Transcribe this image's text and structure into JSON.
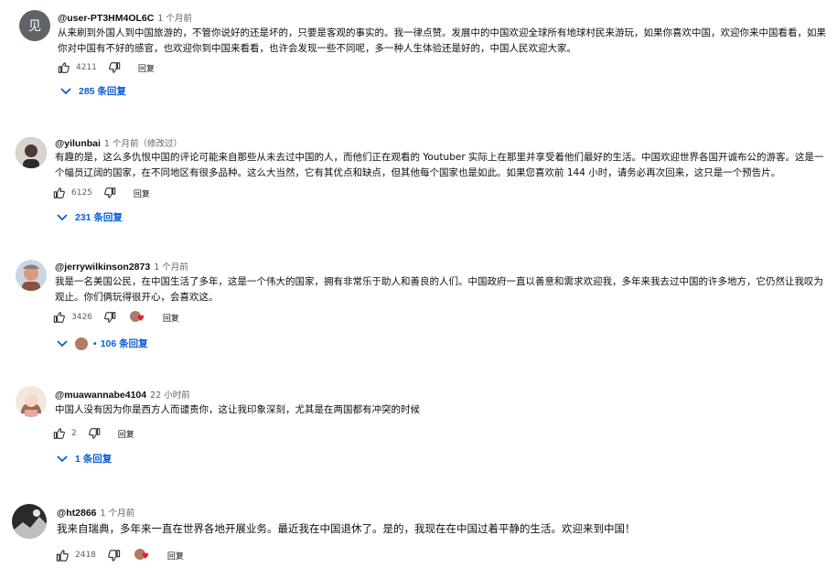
{
  "comments": [
    {
      "avatar_letter": "见",
      "author": "@user-PT3HM4OL6C",
      "time": "1 个月前",
      "text": "从来刷到外国人到中国旅游的，不管你说好的还是坏的，只要是客观的事实的。我一律点赞。发展中的中国欢迎全球所有地球村民来游玩，如果你喜欢中国，欢迎你来中国看看，如果你对中国有不好的感官，也欢迎你到中国来看看，也许会发现一些不同呢，多一种人生体验还是好的，中国人民欢迎大家。",
      "likes": "4211",
      "reply_label": "回复",
      "replies_label": "285 条回复"
    },
    {
      "author": "@yilunbai",
      "time": "1 个月前（修改过）",
      "text": "有趣的是，这么多仇恨中国的评论可能来自那些从未去过中国的人，而他们正在观看的 Youtuber 实际上在那里并享受着他们最好的生活。中国欢迎世界各国开诚布公的游客。这是一个幅员辽阔的国家，在不同地区有很多品种。这么大当然，它有其优点和缺点，但其他每个国家也是如此。如果您喜欢前 144 小时，请务必再次回来，这只是一个预告片。",
      "likes": "6125",
      "reply_label": "回复",
      "replies_label": "231 条回复"
    },
    {
      "author": "@jerrywilkinson2873",
      "time": "1 个月前",
      "text": "我是一名美国公民，在中国生活了多年，这是一个伟大的国家，拥有非常乐于助人和善良的人们。中国政府一直以善意和需求欢迎我，多年来我去过中国的许多地方，它仍然让我叹为观止。你们俩玩得很开心，会喜欢这。",
      "likes": "3426",
      "reply_label": "回复",
      "replies_label": "106 条回复"
    },
    {
      "author": "@muawannabe4104",
      "time": "22 小时前",
      "text": "中国人没有因为你是西方人而谴责你，这让我印象深刻，尤其是在两国都有冲突的时候",
      "likes": "2",
      "reply_label": "回复",
      "replies_label": "1 条回复"
    },
    {
      "author": "@ht2866",
      "time": "1 个月前",
      "text": "我来自瑞典，多年来一直在世界各地开展业务。最近我在中国退休了。是的，我现在在中国过着平静的生活。欢迎来到中国！",
      "likes": "2418",
      "reply_label": "回复"
    }
  ]
}
